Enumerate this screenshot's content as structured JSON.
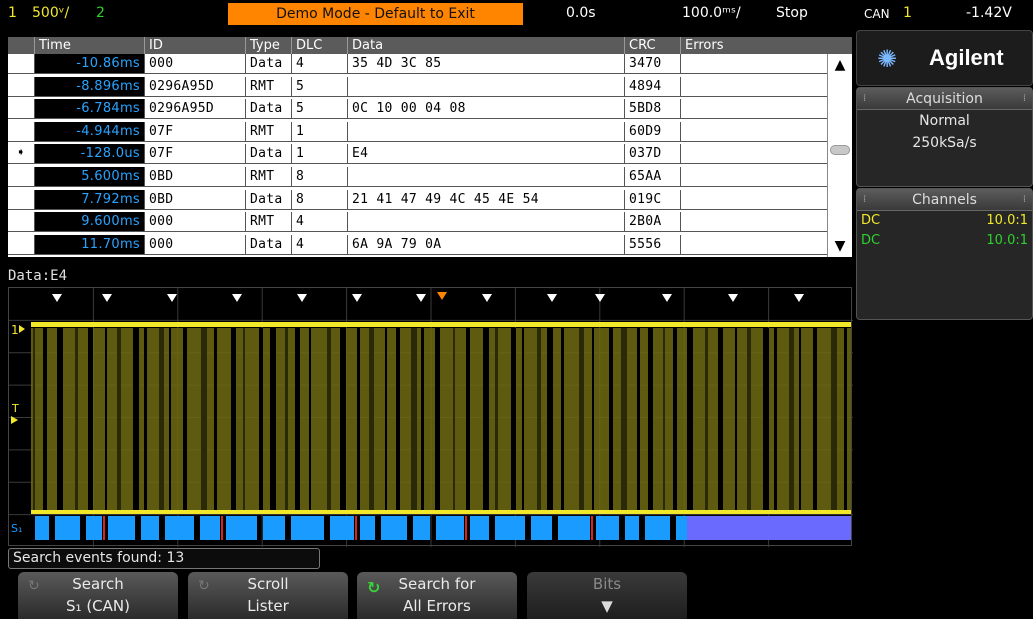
{
  "topbar": {
    "ch1_num": "1",
    "ch1_scale": "500ᵛ/",
    "ch2_num": "2",
    "banner": "Demo Mode - Default to Exit",
    "time_delay": "0.0s",
    "timebase": "100.0ᵐˢ/",
    "run_state": "Stop",
    "trigger_type": "CAN",
    "trigger_source": "1",
    "trigger_level": "-1.42V"
  },
  "lister": {
    "columns": [
      "Time",
      "ID",
      "Type",
      "DLC",
      "Data",
      "CRC",
      "Errors"
    ],
    "rows": [
      {
        "time": "-10.86ms",
        "id": "000",
        "type": "Data",
        "dlc": "4",
        "data": "35 4D 3C 85",
        "crc": "3470",
        "errors": "",
        "marker": ""
      },
      {
        "time": "-8.896ms",
        "id": "0296A95D",
        "type": "RMT",
        "dlc": "5",
        "data": "",
        "crc": "4894",
        "errors": "",
        "marker": ""
      },
      {
        "time": "-6.784ms",
        "id": "0296A95D",
        "type": "Data",
        "dlc": "5",
        "data": "0C 10 00 04 08",
        "crc": "5BD8",
        "errors": "",
        "marker": ""
      },
      {
        "time": "-4.944ms",
        "id": "07F",
        "type": "RMT",
        "dlc": "1",
        "data": "",
        "crc": "60D9",
        "errors": "",
        "marker": ""
      },
      {
        "time": "-128.0us",
        "id": "07F",
        "type": "Data",
        "dlc": "1",
        "data": "E4",
        "crc": "037D",
        "errors": "",
        "marker": "➧"
      },
      {
        "time": "5.600ms",
        "id": "0BD",
        "type": "RMT",
        "dlc": "8",
        "data": "",
        "crc": "65AA",
        "errors": "",
        "marker": ""
      },
      {
        "time": "7.792ms",
        "id": "0BD",
        "type": "Data",
        "dlc": "8",
        "data": "21 41 47 49 4C 45 4E 54",
        "crc": "019C",
        "errors": "",
        "marker": ""
      },
      {
        "time": "9.600ms",
        "id": "000",
        "type": "RMT",
        "dlc": "4",
        "data": "",
        "crc": "2B0A",
        "errors": "",
        "marker": ""
      },
      {
        "time": "11.70ms",
        "id": "000",
        "type": "Data",
        "dlc": "4",
        "data": "6A 9A 79 0A",
        "crc": "5556",
        "errors": "",
        "marker": ""
      }
    ],
    "scroll_up_icon": "arrow-up-icon",
    "scroll_down_icon": "arrow-down-icon"
  },
  "side": {
    "brand": "Agilent",
    "brand_icon": "agilent-spark-icon",
    "acquisition_title": "Acquisition",
    "acq_mode": "Normal",
    "acq_rate": "250kSa/s",
    "channels_title": "Channels",
    "channels": [
      {
        "coupling": "DC",
        "probe": "10.0:1",
        "color": "#f2e82a"
      },
      {
        "coupling": "DC",
        "probe": "10.0:1",
        "color": "#2ed12e"
      }
    ]
  },
  "scope": {
    "decode_label": "Data:E4",
    "ch1_marker": "1",
    "trigger_marker": "T",
    "serial_marker": "S₁",
    "colors": {
      "ch1": "#f2e82a",
      "grid": "#3a3a3a",
      "serial": "#1a9bff",
      "serial_idle": "#6a6aff",
      "error": "#e02020",
      "marker_orange": "#ff8400"
    }
  },
  "status": {
    "message": "Search events found: 13"
  },
  "softkeys": [
    {
      "l1": "Search",
      "l2": "S₁ (CAN)",
      "icon": "rotate-icon"
    },
    {
      "l1": "Scroll",
      "l2": "Lister",
      "icon": "rotate-icon"
    },
    {
      "l1": "Search for",
      "l2": "All Errors",
      "icon": "green-rotate-icon"
    },
    {
      "l1": "Bits",
      "l2": "▼",
      "icon": ""
    }
  ]
}
